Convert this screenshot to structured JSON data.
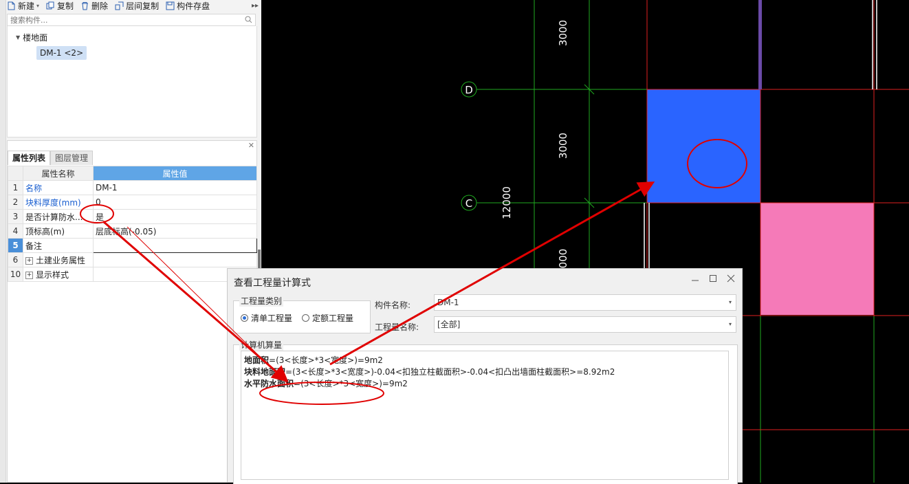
{
  "toolbar": {
    "new_label": "新建",
    "copy_label": "复制",
    "delete_label": "删除",
    "floor_copy_label": "层间复制",
    "save_label": "构件存盘"
  },
  "search": {
    "placeholder": "搜索构件..."
  },
  "tree": {
    "group_label": "楼地面",
    "item_label": "DM-1 <2>"
  },
  "prop_panel": {
    "tabs": [
      "属性列表",
      "图层管理"
    ],
    "header_name": "属性名称",
    "header_value": "属性值",
    "rows": [
      {
        "num": "1",
        "name": "名称",
        "value": "DM-1"
      },
      {
        "num": "2",
        "name": "块料厚度(mm)",
        "value": "0"
      },
      {
        "num": "3",
        "name": "是否计算防水...",
        "value": "是"
      },
      {
        "num": "4",
        "name": "顶标高(m)",
        "value": "层底标高(-0.05)"
      },
      {
        "num": "5",
        "name": "备注",
        "value": ""
      },
      {
        "num": "6",
        "name": "土建业务属性",
        "value": ""
      },
      {
        "num": "10",
        "name": "显示样式",
        "value": ""
      }
    ]
  },
  "cad": {
    "dim_labels": [
      "3000",
      "3000",
      "12000",
      "000"
    ],
    "axis_labels": [
      "D",
      "C"
    ],
    "colors": {
      "grid": "#1faa1f",
      "wall": "#e02020",
      "selected_slab": "#2a64ff",
      "pink_slab": "#f57ab8"
    }
  },
  "dialog": {
    "title": "查看工程量计算式",
    "type_legend": "工程量类别",
    "radio_list": "清单工程量",
    "radio_quota": "定额工程量",
    "component_label": "构件名称:",
    "component_value": "DM-1",
    "quantity_label": "工程量名称:",
    "quantity_value": "[全部]",
    "calc_legend": "计算机算量",
    "calc_lines": [
      {
        "label": "地面积",
        "formula": "=(3<长度>*3<宽度>)=9m2"
      },
      {
        "label": "块料地面积",
        "formula": "=(3<长度>*3<宽度>)-0.04<扣独立柱截面积>-0.04<扣凸出墙面柱截面积>=8.92m2"
      },
      {
        "label": "水平防水面积",
        "formula": "=(3<长度>*3<宽度>)=9m2"
      }
    ]
  },
  "annotation_color": "#e00000"
}
